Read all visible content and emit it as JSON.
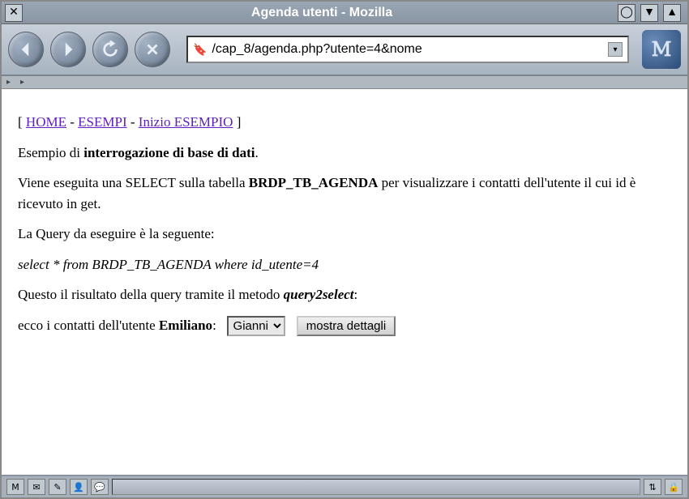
{
  "window": {
    "title": "Agenda utenti - Mozilla"
  },
  "url_bar": {
    "value": "/cap_8/agenda.php?utente=4&nome"
  },
  "breadcrumb": {
    "open": "[ ",
    "home": "HOME",
    "sep1": " - ",
    "esempi": "ESEMPI",
    "sep2": " - ",
    "inizio": "Inizio ESEMPIO",
    "close": " ]"
  },
  "para1": {
    "pre": "Esempio di ",
    "bold": "interrogazione di base di dati",
    "post": "."
  },
  "para2": {
    "pre": "Viene eseguita una SELECT sulla tabella ",
    "bold": "BRDP_TB_AGENDA",
    "post": " per visualizzare i contatti dell'utente il cui id è ricevuto in get."
  },
  "para3": "La Query da eseguire è la seguente:",
  "query_text": "select * from BRDP_TB_AGENDA where id_utente=4",
  "para4": {
    "pre": "Questo il risultato della query tramite il metodo ",
    "bolditalic": "query2select",
    "post": ":"
  },
  "contacts": {
    "pre": "ecco i contatti dell'utente ",
    "user": "Emiliano",
    "post": ": ",
    "selected": "Gianni",
    "button": "mostra dettagli"
  }
}
